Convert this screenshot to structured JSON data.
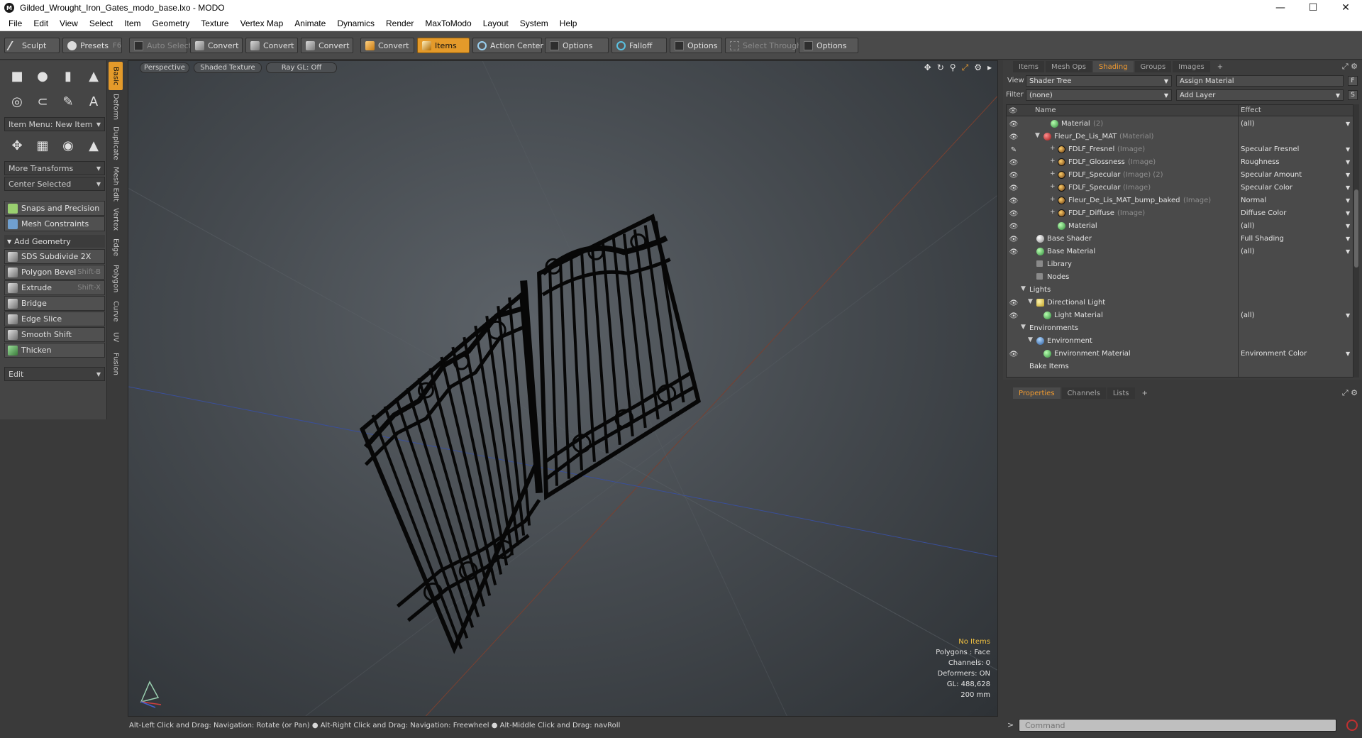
{
  "window": {
    "title": "Gilded_Wrought_Iron_Gates_modo_base.lxo - MODO",
    "minimize": "—",
    "maximize": "☐",
    "close": "✕"
  },
  "menu": [
    "File",
    "Edit",
    "View",
    "Select",
    "Item",
    "Geometry",
    "Texture",
    "Vertex Map",
    "Animate",
    "Dynamics",
    "Render",
    "MaxToModo",
    "Layout",
    "System",
    "Help"
  ],
  "toolbar": {
    "sculpt": "Sculpt",
    "presets": "Presets",
    "presets_key": "F6",
    "auto_select": "Auto Select",
    "convert1": "Convert",
    "convert2": "Convert",
    "convert3": "Convert",
    "convert4": "Convert",
    "items": "Items",
    "action_center": "Action Center",
    "options1": "Options",
    "falloff": "Falloff",
    "options2": "Options",
    "select_through": "Select Through",
    "options3": "Options"
  },
  "left": {
    "item_menu": "Item Menu: New Item",
    "more_transforms": "More Transforms",
    "center_selected": "Center Selected",
    "snaps": "Snaps and Precision",
    "mesh_constraints": "Mesh Constraints",
    "add_geometry": "Add Geometry",
    "tools": [
      {
        "label": "SDS Subdivide 2X",
        "shortcut": ""
      },
      {
        "label": "Polygon Bevel",
        "shortcut": "Shift-B"
      },
      {
        "label": "Extrude",
        "shortcut": "Shift-X"
      },
      {
        "label": "Bridge",
        "shortcut": ""
      },
      {
        "label": "Edge Slice",
        "shortcut": ""
      },
      {
        "label": "Smooth Shift",
        "shortcut": ""
      },
      {
        "label": "Thicken",
        "shortcut": ""
      }
    ],
    "edit": "Edit",
    "vtabs": [
      "Basic",
      "Deform",
      "Duplicate",
      "Mesh Edit",
      "Vertex",
      "Edge",
      "Polygon",
      "Curve",
      "UV",
      "Fusion"
    ]
  },
  "viewport": {
    "perspective": "Perspective",
    "shaded": "Shaded Texture",
    "raygl": "Ray GL: Off",
    "info": {
      "no_items": "No Items",
      "polygons": "Polygons : Face",
      "channels": "Channels: 0",
      "deformers": "Deformers: ON",
      "gl": "GL: 488,628",
      "size": "200 mm"
    }
  },
  "status": "Alt-Left Click and Drag: Navigation: Rotate (or Pan) ● Alt-Right Click and Drag: Navigation: Freewheel ● Alt-Middle Click and Drag: navRoll",
  "command": {
    "placeholder": "Command",
    "prompt": ">"
  },
  "right": {
    "tabs": [
      "Items",
      "Mesh Ops",
      "Shading",
      "Groups",
      "Images",
      "+"
    ],
    "view_label": "View",
    "view_value": "Shader Tree",
    "assign_material": "Assign Material",
    "filter_label": "Filter",
    "filter_value": "(none)",
    "add_layer": "Add Layer",
    "btn_f": "F",
    "btn_s": "S",
    "col_name": "Name",
    "col_effect": "Effect",
    "rows": [
      {
        "indent": 3,
        "icon": "mat",
        "name": "Material",
        "type": "(2)",
        "effect": "(all)",
        "eye": true
      },
      {
        "indent": 2,
        "icon": "redmat",
        "name": "Fleur_De_Lis_MAT",
        "type": "(Material)",
        "effect": "",
        "eye": true,
        "expanded": true
      },
      {
        "indent": 4,
        "icon": "img",
        "name": "FDLF_Fresnel",
        "type": "(Image)",
        "effect": "Specular Fresnel",
        "eye": "brush",
        "plus": true
      },
      {
        "indent": 4,
        "icon": "img",
        "name": "FDLF_Glossness",
        "type": "(Image)",
        "effect": "Roughness",
        "eye": true,
        "plus": true
      },
      {
        "indent": 4,
        "icon": "img",
        "name": "FDLF_Specular",
        "type": "(Image) (2)",
        "effect": "Specular Amount",
        "eye": true,
        "plus": true
      },
      {
        "indent": 4,
        "icon": "img",
        "name": "FDLF_Specular",
        "type": "(Image)",
        "effect": "Specular Color",
        "eye": true,
        "plus": true
      },
      {
        "indent": 4,
        "icon": "img",
        "name": "Fleur_De_Lis_MAT_bump_baked",
        "type": "(Image)",
        "effect": "Normal",
        "eye": true,
        "plus": true
      },
      {
        "indent": 4,
        "icon": "img",
        "name": "FDLF_Diffuse",
        "type": "(Image)",
        "effect": "Diffuse Color",
        "eye": true,
        "plus": true
      },
      {
        "indent": 4,
        "icon": "mat",
        "name": "Material",
        "type": "",
        "effect": "(all)",
        "eye": true
      },
      {
        "indent": 1,
        "icon": "shader",
        "name": "Base Shader",
        "type": "",
        "effect": "Full Shading",
        "eye": true
      },
      {
        "indent": 1,
        "icon": "mat",
        "name": "Base Material",
        "type": "",
        "effect": "(all)",
        "eye": true
      },
      {
        "indent": 1,
        "icon": "folder",
        "name": "Library",
        "type": "",
        "effect": "",
        "eye": false
      },
      {
        "indent": 1,
        "icon": "folder",
        "name": "Nodes",
        "type": "",
        "effect": "",
        "eye": false
      },
      {
        "indent": 0,
        "icon": "none",
        "name": "Lights",
        "type": "",
        "effect": "",
        "eye": false,
        "expanded": true
      },
      {
        "indent": 1,
        "icon": "light",
        "name": "Directional Light",
        "type": "",
        "effect": "",
        "eye": true,
        "expanded": true
      },
      {
        "indent": 2,
        "icon": "mat",
        "name": "Light Material",
        "type": "",
        "effect": "(all)",
        "eye": true
      },
      {
        "indent": 0,
        "icon": "none",
        "name": "Environments",
        "type": "",
        "effect": "",
        "eye": false,
        "expanded": true
      },
      {
        "indent": 1,
        "icon": "env",
        "name": "Environment",
        "type": "",
        "effect": "",
        "eye": false,
        "expanded": true
      },
      {
        "indent": 2,
        "icon": "mat",
        "name": "Environment Material",
        "type": "",
        "effect": "Environment Color",
        "eye": true
      },
      {
        "indent": 0,
        "icon": "none",
        "name": "Bake Items",
        "type": "",
        "effect": "",
        "eye": false
      }
    ],
    "bottom_tabs": [
      "Properties",
      "Channels",
      "Lists",
      "+"
    ]
  }
}
